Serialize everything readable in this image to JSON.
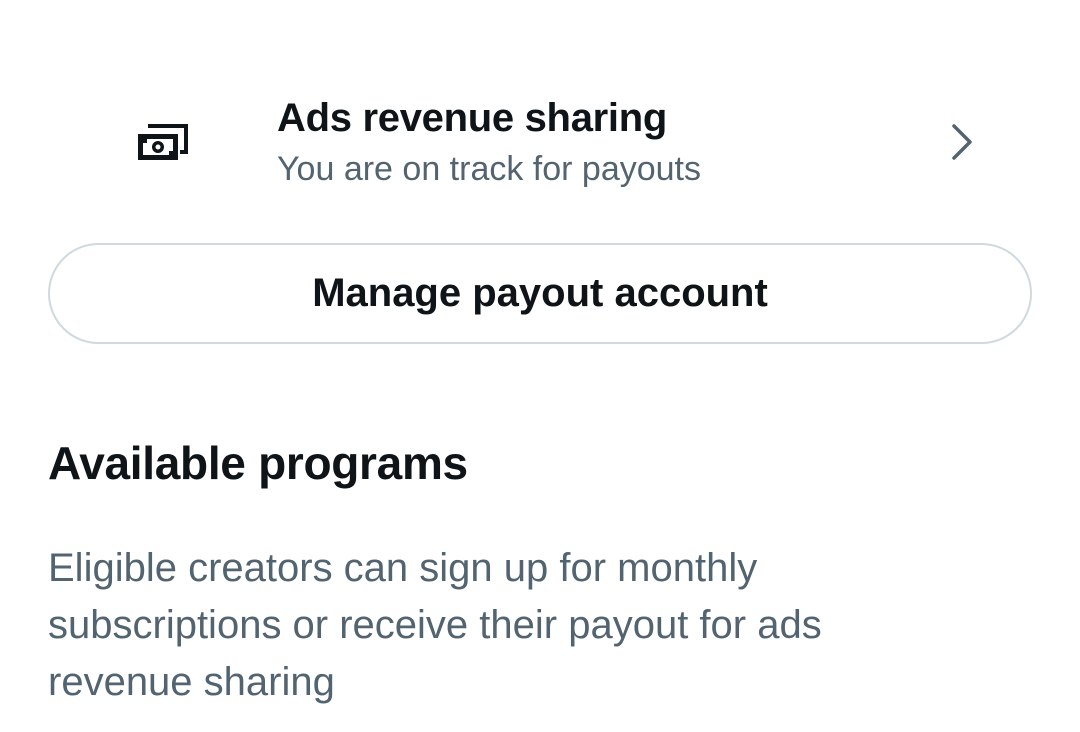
{
  "program": {
    "icon": "money-icon",
    "title": "Ads revenue sharing",
    "subtitle": "You are on track for payouts",
    "chevron_icon": "chevron-right-icon"
  },
  "manage_button": {
    "label": "Manage payout account"
  },
  "available_programs": {
    "heading": "Available programs",
    "description": "Eligible creators can sign up for monthly subscriptions or receive their payout for ads revenue sharing"
  },
  "colors": {
    "primary_text": "#0f1419",
    "secondary_text": "#536471",
    "border": "#cfd9de",
    "background": "#ffffff"
  }
}
